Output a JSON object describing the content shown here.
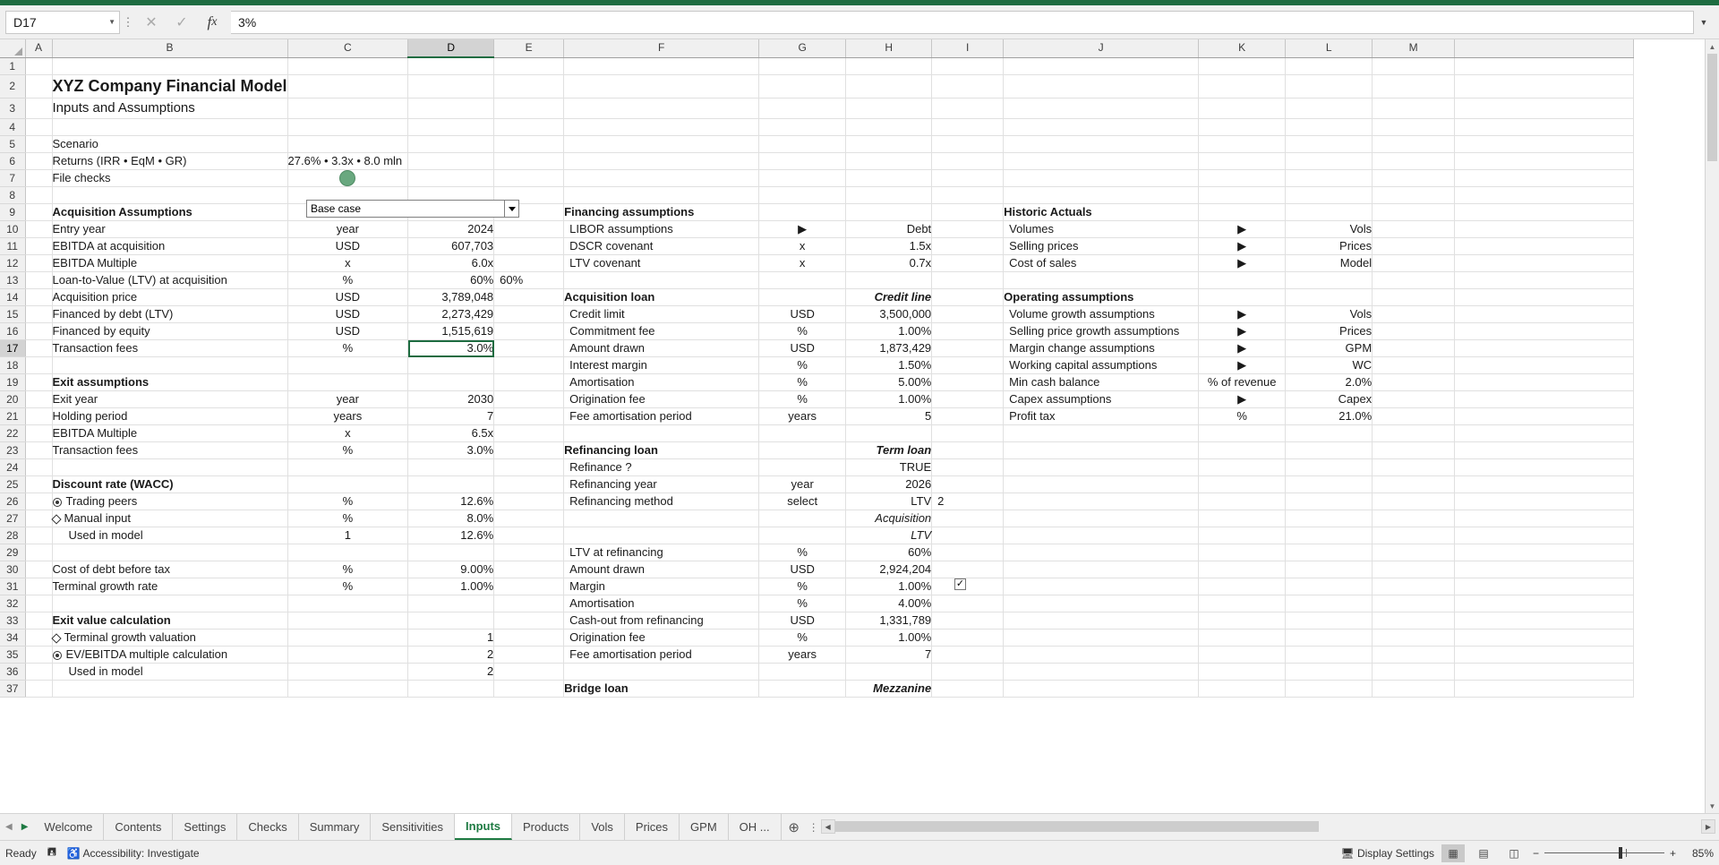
{
  "formula_bar": {
    "name_box": "D17",
    "formula": "3%",
    "cancel_icon": "close-icon",
    "confirm_icon": "check-icon",
    "fx_icon": "fx-icon"
  },
  "columns": [
    "A",
    "B",
    "C",
    "D",
    "E",
    "F",
    "G",
    "H",
    "I",
    "J",
    "K",
    "L",
    "M"
  ],
  "selected_column": "D",
  "rows": [
    1,
    2,
    3,
    4,
    5,
    6,
    7,
    8,
    9,
    10,
    11,
    12,
    13,
    14,
    15,
    16,
    17,
    18,
    19,
    20,
    21,
    22,
    23,
    24,
    25,
    26,
    27,
    28,
    29,
    30,
    31,
    32,
    33,
    34,
    35,
    36,
    37
  ],
  "titles": {
    "main": "XYZ Company Financial Model",
    "subtitle": "Inputs and Assumptions"
  },
  "scenario_panel": {
    "scenario_label": "Scenario",
    "scenario_value": "Base case",
    "returns_label": "Returns (IRR • EqM • GR)",
    "returns_value": "27.6% • 3.3x • 8.0 mln",
    "file_checks_label": "File checks",
    "file_checks_status": "ok-green-dot"
  },
  "acquisition": {
    "header": "Acquisition Assumptions",
    "rows": [
      {
        "label": "Entry year",
        "unit": "year",
        "value": "2024",
        "style": "green"
      },
      {
        "label": "EBITDA at acquisition",
        "unit": "USD",
        "value": "607,703",
        "style": "plain"
      },
      {
        "label": "EBITDA Multiple",
        "unit": "x",
        "value": "6.0x",
        "style": "input"
      },
      {
        "label": "Loan-to-Value (LTV) at acquisition",
        "unit": "%",
        "value": "60%",
        "style": "input",
        "spill": "60%"
      },
      {
        "label": "Acquisition price",
        "unit": "USD",
        "value": "3,789,048",
        "style": "plain"
      },
      {
        "label": "  Financed by debt (LTV)",
        "unit": "USD",
        "value": "2,273,429",
        "style": "plain"
      },
      {
        "label": "  Financed by equity",
        "unit": "USD",
        "value": "1,515,619",
        "style": "plain"
      },
      {
        "label": "Transaction fees",
        "unit": "%",
        "value": "3.0%",
        "style": "input-selected"
      }
    ]
  },
  "exit": {
    "header": "Exit assumptions",
    "rows": [
      {
        "label": "Exit year",
        "unit": "year",
        "value": "2030",
        "style": "input"
      },
      {
        "label": "Holding period",
        "unit": "years",
        "value": "7",
        "style": "plain"
      },
      {
        "label": "EBITDA Multiple",
        "unit": "x",
        "value": "6.5x",
        "style": "input"
      },
      {
        "label": "Transaction fees",
        "unit": "%",
        "value": "3.0%",
        "style": "input"
      }
    ]
  },
  "wacc": {
    "header": "Discount rate (WACC)",
    "rows": [
      {
        "label": "Trading peers",
        "unit": "%",
        "value": "12.6%",
        "style": "green",
        "marker": "radio-on"
      },
      {
        "label": "Manual input",
        "unit": "%",
        "value": "8.0%",
        "style": "input",
        "marker": "diamond-off"
      },
      {
        "label": "  Used in model",
        "unit": "1",
        "value": "12.6%",
        "style": "grey"
      }
    ]
  },
  "cost_rows": [
    {
      "label": "Cost of debt before tax",
      "unit": "%",
      "value": "9.00%",
      "style": "input"
    },
    {
      "label": "Terminal growth rate",
      "unit": "%",
      "value": "1.00%",
      "style": "input"
    }
  ],
  "exit_value": {
    "header": "Exit value calculation",
    "rows": [
      {
        "label": "Terminal growth valuation",
        "unit": "",
        "value": "1",
        "style": "plain",
        "marker": "diamond-off"
      },
      {
        "label": "EV/EBITDA multiple calculation",
        "unit": "",
        "value": "2",
        "style": "plain",
        "marker": "radio-on"
      },
      {
        "label": "  Used in model",
        "unit": "",
        "value": "2",
        "style": "grey"
      }
    ]
  },
  "financing": {
    "header": "Financing assumptions",
    "rows": [
      {
        "label": "LIBOR assumptions",
        "unit": "",
        "marker": "arrow",
        "value": "Debt",
        "style": "plain"
      },
      {
        "label": "DSCR covenant",
        "unit": "x",
        "value": "1.5x",
        "style": "input"
      },
      {
        "label": "LTV covenant",
        "unit": "x",
        "value": "0.7x",
        "style": "input"
      }
    ]
  },
  "acq_loan": {
    "header": "Acquisition loan",
    "header_right": "Credit line",
    "rows": [
      {
        "label": "Credit limit",
        "unit": "USD",
        "value": "3,500,000",
        "style": "input"
      },
      {
        "label": "Commitment fee",
        "unit": "%",
        "value": "1.00%",
        "style": "input"
      },
      {
        "label": "Amount drawn",
        "unit": "USD",
        "value": "1,873,429",
        "style": "plain"
      },
      {
        "label": "Interest margin",
        "unit": "%",
        "value": "1.50%",
        "style": "input"
      },
      {
        "label": "Amortisation",
        "unit": "%",
        "value": "5.00%",
        "style": "input"
      },
      {
        "label": "Origination fee",
        "unit": "%",
        "value": "1.00%",
        "style": "input"
      },
      {
        "label": "Fee amortisation period",
        "unit": "years",
        "value": "5",
        "style": "input"
      }
    ]
  },
  "refi_loan": {
    "header": "Refinancing loan",
    "header_right": "Term loan",
    "rows": [
      {
        "label": "Refinance ?",
        "unit": "",
        "value": "TRUE",
        "style": "grey",
        "control": "checkbox-checked"
      },
      {
        "label": "Refinancing year",
        "unit": "year",
        "value": "2026",
        "style": "input"
      },
      {
        "label": "Refinancing method",
        "unit": "select",
        "value": "LTV",
        "style": "input",
        "spill": "2"
      },
      {
        "label": "",
        "unit": "",
        "value": "Acquisition",
        "style": "blue-italic"
      },
      {
        "label": "",
        "unit": "",
        "value": "LTV",
        "style": "blue-italic"
      },
      {
        "label": "LTV at refinancing",
        "unit": "%",
        "value": "60%",
        "style": "input"
      },
      {
        "label": "Amount drawn",
        "unit": "USD",
        "value": "2,924,204",
        "style": "plain"
      },
      {
        "label": "Margin",
        "unit": "%",
        "value": "1.00%",
        "style": "input"
      },
      {
        "label": "Amortisation",
        "unit": "%",
        "value": "4.00%",
        "style": "input"
      },
      {
        "label": "Cash-out from refinancing",
        "unit": "USD",
        "value": "1,331,789",
        "style": "plain"
      },
      {
        "label": "Origination fee",
        "unit": "%",
        "value": "1.00%",
        "style": "input"
      },
      {
        "label": "Fee amortisation period",
        "unit": "years",
        "value": "7",
        "style": "input"
      }
    ]
  },
  "bridge_loan": {
    "header": "Bridge loan",
    "header_right": "Mezzanine"
  },
  "historic": {
    "header": "Historic Actuals",
    "rows": [
      {
        "label": "Volumes",
        "marker": "arrow",
        "value": "Vols"
      },
      {
        "label": "Selling prices",
        "marker": "arrow",
        "value": "Prices"
      },
      {
        "label": "Cost of sales",
        "marker": "arrow",
        "value": "Model"
      }
    ]
  },
  "operating": {
    "header": "Operating assumptions",
    "rows": [
      {
        "label": "Volume growth assumptions",
        "unit": "",
        "marker": "arrow",
        "value": "Vols",
        "style": "plain"
      },
      {
        "label": "Selling price growth assumptions",
        "unit": "",
        "marker": "arrow",
        "value": "Prices",
        "style": "plain"
      },
      {
        "label": "Margin change assumptions",
        "unit": "",
        "marker": "arrow",
        "value": "GPM",
        "style": "plain"
      },
      {
        "label": "Working capital assumptions",
        "unit": "",
        "marker": "arrow",
        "value": "WC",
        "style": "plain"
      },
      {
        "label": "Min cash balance",
        "unit": "% of revenue",
        "value": "2.0%",
        "style": "input"
      },
      {
        "label": "Capex assumptions",
        "unit": "",
        "marker": "arrow",
        "value": "Capex",
        "style": "plain"
      },
      {
        "label": "Profit tax",
        "unit": "%",
        "value": "21.0%",
        "style": "input"
      }
    ]
  },
  "sheet_tabs": {
    "items": [
      "Welcome",
      "Contents",
      "Settings",
      "Checks",
      "Summary",
      "Sensitivities",
      "Inputs",
      "Products",
      "Vols",
      "Prices",
      "GPM",
      "OH ..."
    ],
    "active": "Inputs",
    "add_label": "+"
  },
  "status_bar": {
    "state": "Ready",
    "macro_icon": "record-macro-icon",
    "accessibility": "Accessibility: Investigate",
    "display_settings": "Display Settings",
    "zoom": "85%",
    "zoom_out": "−",
    "zoom_in": "+",
    "views": [
      "normal-view-icon",
      "page-layout-icon",
      "page-break-icon"
    ]
  },
  "colors": {
    "section_header_bg": "#1f4e79",
    "input_bg": "#dce6f1",
    "input_text": "#1f4e79",
    "formula_green": "#1e7a42",
    "accent_green": "#1e6c41"
  }
}
